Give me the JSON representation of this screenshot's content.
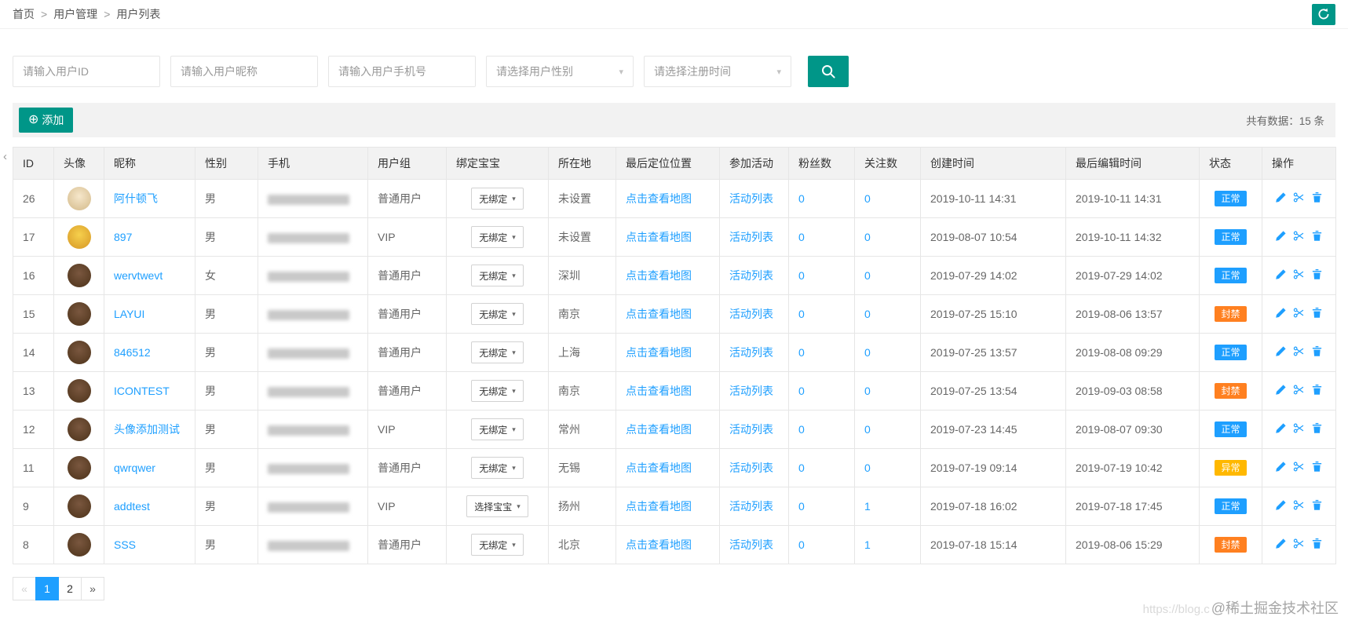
{
  "breadcrumb": {
    "separator": ">",
    "items": [
      "首页",
      "用户管理",
      "用户列表"
    ]
  },
  "filters": {
    "id_placeholder": "请输入用户ID",
    "nickname_placeholder": "请输入用户昵称",
    "phone_placeholder": "请输入用户手机号",
    "gender_placeholder": "请选择用户性别",
    "regtime_placeholder": "请选择注册时间"
  },
  "toolbar": {
    "add_label": "添加",
    "total_label": "共有数据：15 条"
  },
  "icons": {
    "add": "⊕",
    "caret": "▾",
    "prev": "«",
    "next": "»",
    "collapse": "‹"
  },
  "colors": {
    "primary": "#009688",
    "link": "#1E9FFF",
    "normal": "#1E9FFF",
    "banned": "#FF8020",
    "abnormal": "#FFB800"
  },
  "table": {
    "columns": [
      "ID",
      "头像",
      "昵称",
      "性别",
      "手机",
      "用户组",
      "绑定宝宝",
      "所在地",
      "最后定位位置",
      "参加活动",
      "粉丝数",
      "关注数",
      "创建时间",
      "最后编辑时间",
      "状态",
      "操作"
    ],
    "map_link": "点击查看地图",
    "activity_link": "活动列表",
    "rows": [
      {
        "id": "26",
        "avatar_c1": "#f6e7cb",
        "avatar_c2": "#d8c093",
        "nickname": "阿什顿飞",
        "gender": "男",
        "group": "普通用户",
        "bind": "无绑定",
        "location": "未设置",
        "fans": "0",
        "follows": "0",
        "created": "2019-10-11 14:31",
        "edited": "2019-10-11 14:31",
        "status": "正常",
        "status_type": "normal"
      },
      {
        "id": "17",
        "avatar_c1": "#f6d04d",
        "avatar_c2": "#db9f2b",
        "nickname": "897",
        "gender": "男",
        "group": "VIP",
        "bind": "无绑定",
        "location": "未设置",
        "fans": "0",
        "follows": "0",
        "created": "2019-08-07 10:54",
        "edited": "2019-10-11 14:32",
        "status": "正常",
        "status_type": "normal"
      },
      {
        "id": "16",
        "avatar_c1": "#7a573f",
        "avatar_c2": "#53381f",
        "nickname": "wervtwevt",
        "gender": "女",
        "group": "普通用户",
        "bind": "无绑定",
        "location": "深圳",
        "fans": "0",
        "follows": "0",
        "created": "2019-07-29 14:02",
        "edited": "2019-07-29 14:02",
        "status": "正常",
        "status_type": "normal"
      },
      {
        "id": "15",
        "avatar_c1": "#7a573f",
        "avatar_c2": "#53381f",
        "nickname": "LAYUI",
        "gender": "男",
        "group": "普通用户",
        "bind": "无绑定",
        "location": "南京",
        "fans": "0",
        "follows": "0",
        "created": "2019-07-25 15:10",
        "edited": "2019-08-06 13:57",
        "status": "封禁",
        "status_type": "banned"
      },
      {
        "id": "14",
        "avatar_c1": "#7a573f",
        "avatar_c2": "#53381f",
        "nickname": "846512",
        "gender": "男",
        "group": "普通用户",
        "bind": "无绑定",
        "location": "上海",
        "fans": "0",
        "follows": "0",
        "created": "2019-07-25 13:57",
        "edited": "2019-08-08 09:29",
        "status": "正常",
        "status_type": "normal"
      },
      {
        "id": "13",
        "avatar_c1": "#7a573f",
        "avatar_c2": "#53381f",
        "nickname": "ICONTEST",
        "gender": "男",
        "group": "普通用户",
        "bind": "无绑定",
        "location": "南京",
        "fans": "0",
        "follows": "0",
        "created": "2019-07-25 13:54",
        "edited": "2019-09-03 08:58",
        "status": "封禁",
        "status_type": "banned"
      },
      {
        "id": "12",
        "avatar_c1": "#7a573f",
        "avatar_c2": "#53381f",
        "nickname": "头像添加测试",
        "gender": "男",
        "group": "VIP",
        "bind": "无绑定",
        "location": "常州",
        "fans": "0",
        "follows": "0",
        "created": "2019-07-23 14:45",
        "edited": "2019-08-07 09:30",
        "status": "正常",
        "status_type": "normal"
      },
      {
        "id": "11",
        "avatar_c1": "#7a573f",
        "avatar_c2": "#53381f",
        "nickname": "qwrqwer",
        "gender": "男",
        "group": "普通用户",
        "bind": "无绑定",
        "location": "无锡",
        "fans": "0",
        "follows": "0",
        "created": "2019-07-19 09:14",
        "edited": "2019-07-19 10:42",
        "status": "异常",
        "status_type": "abnormal"
      },
      {
        "id": "9",
        "avatar_c1": "#7a573f",
        "avatar_c2": "#53381f",
        "nickname": "addtest",
        "gender": "男",
        "group": "VIP",
        "bind": "选择宝宝",
        "location": "扬州",
        "fans": "0",
        "follows": "1",
        "created": "2019-07-18 16:02",
        "edited": "2019-07-18 17:45",
        "status": "正常",
        "status_type": "normal"
      },
      {
        "id": "8",
        "avatar_c1": "#7a573f",
        "avatar_c2": "#53381f",
        "nickname": "SSS",
        "gender": "男",
        "group": "普通用户",
        "bind": "无绑定",
        "location": "北京",
        "fans": "0",
        "follows": "1",
        "created": "2019-07-18 15:14",
        "edited": "2019-08-06 15:29",
        "status": "封禁",
        "status_type": "banned"
      }
    ]
  },
  "pagination": {
    "pages": [
      "1",
      "2"
    ],
    "active": "1"
  },
  "watermark": {
    "prefix": "https://blog.c",
    "text": "@稀土掘金技术社区"
  }
}
